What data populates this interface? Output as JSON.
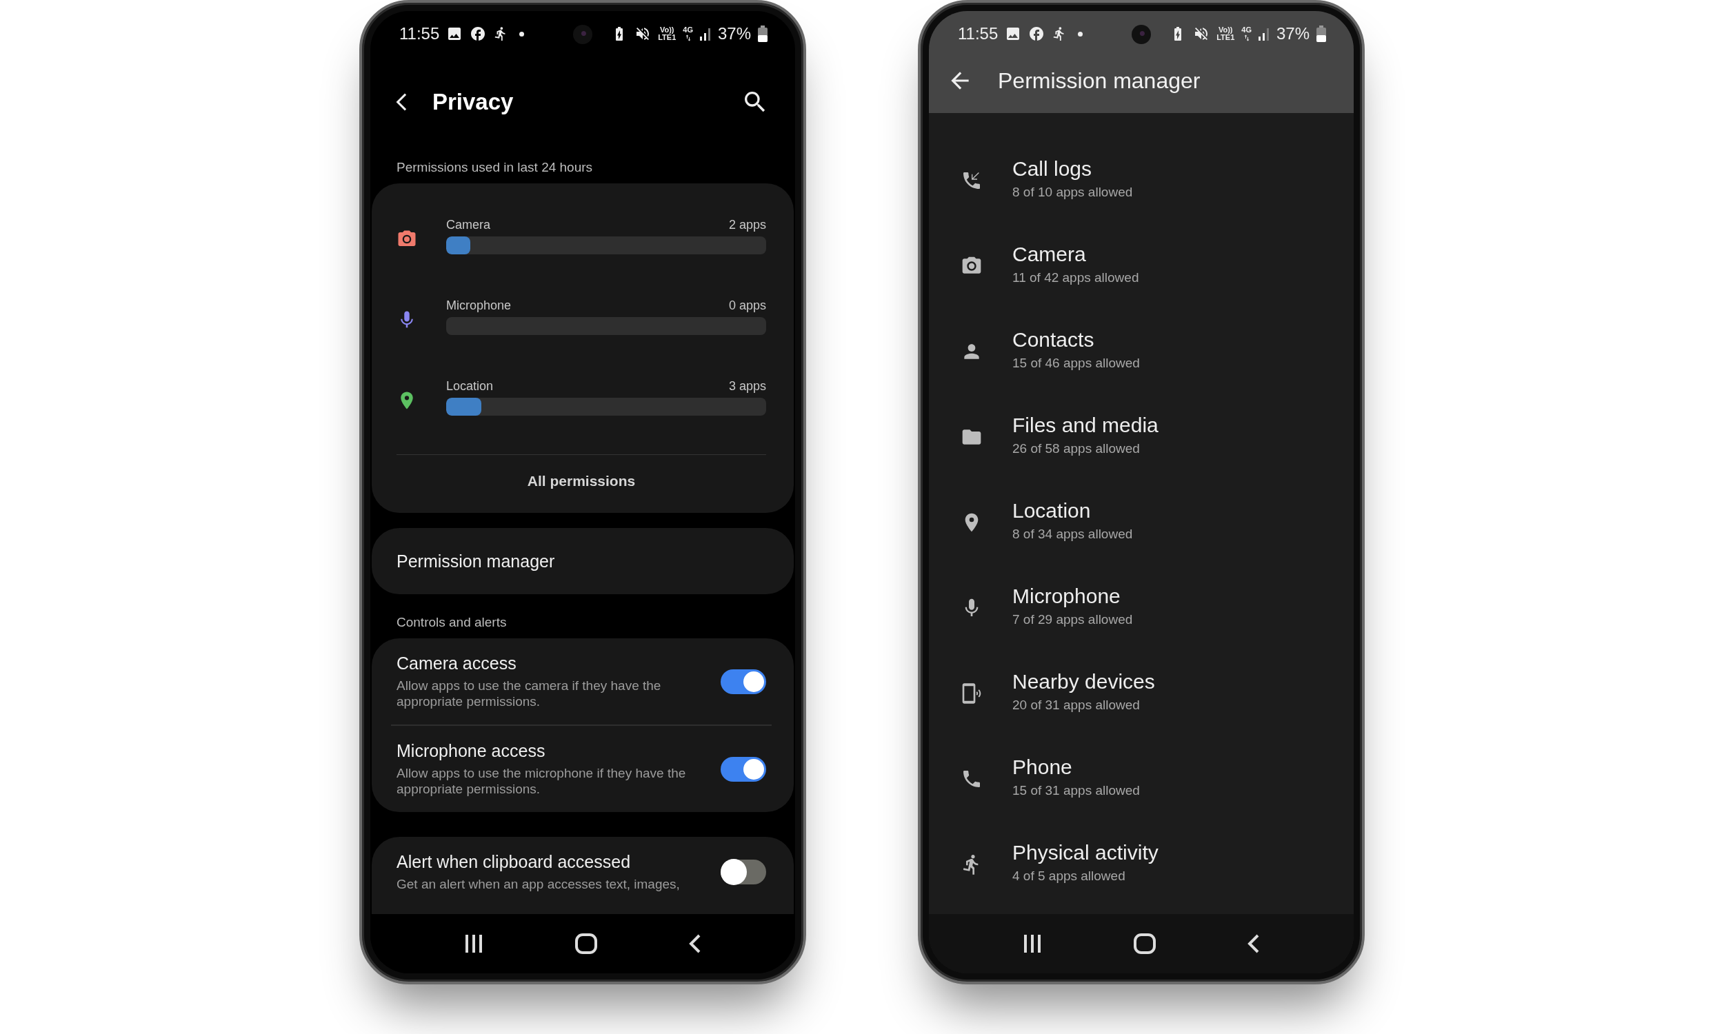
{
  "privacy_screen": {
    "status_bar": {
      "time": "11:55",
      "network": [
        "Vo))",
        "LTE1",
        "4G"
      ],
      "battery": "37%"
    },
    "title": "Privacy",
    "usage_heading": "Permissions used in last 24 hours",
    "usage": [
      {
        "name": "Camera",
        "count": "2 apps",
        "level": 0.075
      },
      {
        "name": "Microphone",
        "count": "0 apps"
      },
      {
        "name": "Location",
        "count": "3 apps",
        "level": 0.11
      }
    ],
    "all_permissions": "All permissions",
    "permission_manager": "Permission manager",
    "controls_heading": "Controls and alerts",
    "controls": [
      {
        "title": "Camera access",
        "description": "Allow apps to use the camera if they have the appropriate permissions.",
        "on": true
      },
      {
        "title": "Microphone access",
        "description": "Allow apps to use the microphone if they have the appropriate permissions.",
        "on": true
      }
    ],
    "clipboard": {
      "title": "Alert when clipboard accessed",
      "description": "Get an alert when an app accesses text, images,",
      "on": false
    }
  },
  "permission_manager_screen": {
    "status_bar": {
      "time": "11:55",
      "network": [
        "Vo))",
        "LTE1",
        "4G"
      ],
      "battery": "37%"
    },
    "title": "Permission manager",
    "items": [
      {
        "name": "Call logs",
        "detail": "8 of 10 apps allowed"
      },
      {
        "name": "Camera",
        "detail": "11 of 42 apps allowed"
      },
      {
        "name": "Contacts",
        "detail": "15 of 46 apps allowed"
      },
      {
        "name": "Files and media",
        "detail": "26 of 58 apps allowed"
      },
      {
        "name": "Location",
        "detail": "8 of 34 apps allowed"
      },
      {
        "name": "Microphone",
        "detail": "7 of 29 apps allowed"
      },
      {
        "name": "Nearby devices",
        "detail": "20 of 31 apps allowed"
      },
      {
        "name": "Phone",
        "detail": "15 of 31 apps allowed"
      },
      {
        "name": "Physical activity",
        "detail": "4 of 5 apps allowed"
      }
    ]
  }
}
